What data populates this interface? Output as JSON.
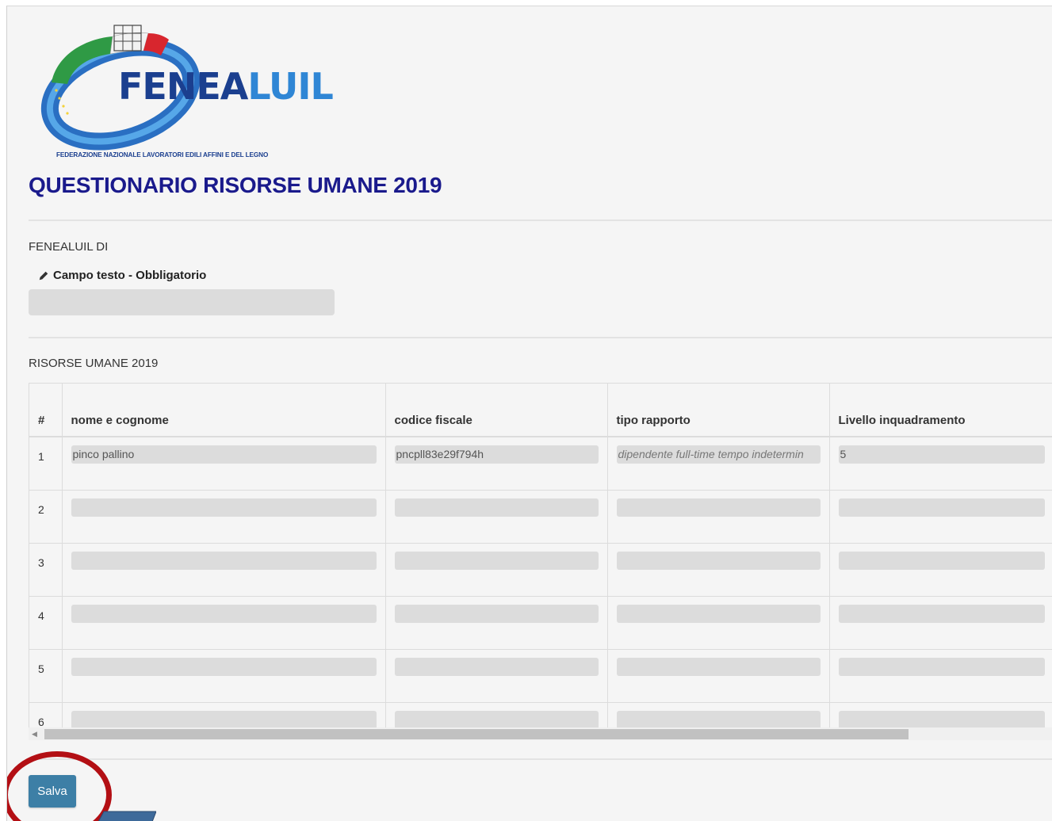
{
  "logo": {
    "wordmark_part1": "FENEA",
    "wordmark_part2": "LUIL",
    "subtitle": "FEDERAZIONE NAZIONALE LAVORATORI EDILI AFFINI E DEL LEGNO"
  },
  "page_title": "QUESTIONARIO RISORSE UMANE 2019",
  "section1": {
    "label": "FENEALUIL DI",
    "field_label": "Campo testo - Obbligatorio",
    "field_value": ""
  },
  "section2": {
    "label": "RISORSE UMANE 2019",
    "columns": [
      "#",
      "nome e cognome",
      "codice fiscale",
      "tipo rapporto",
      "Livello inquadramento"
    ],
    "rows": [
      {
        "num": "1",
        "nome": "pinco pallino",
        "codice": "pncpll83e29f794h",
        "tipo": "dipendente full-time tempo indetermin",
        "livello": "5"
      },
      {
        "num": "2",
        "nome": "",
        "codice": "",
        "tipo": "",
        "livello": ""
      },
      {
        "num": "3",
        "nome": "",
        "codice": "",
        "tipo": "",
        "livello": ""
      },
      {
        "num": "4",
        "nome": "",
        "codice": "",
        "tipo": "",
        "livello": ""
      },
      {
        "num": "5",
        "nome": "",
        "codice": "",
        "tipo": "",
        "livello": ""
      },
      {
        "num": "6",
        "nome": "",
        "codice": "",
        "tipo": "",
        "livello": ""
      }
    ]
  },
  "save_button": "Salva",
  "colors": {
    "title": "#1a1a8c",
    "button": "#3d7fa6",
    "highlight": "#b30f14",
    "pointer": "#3e6a9a"
  }
}
